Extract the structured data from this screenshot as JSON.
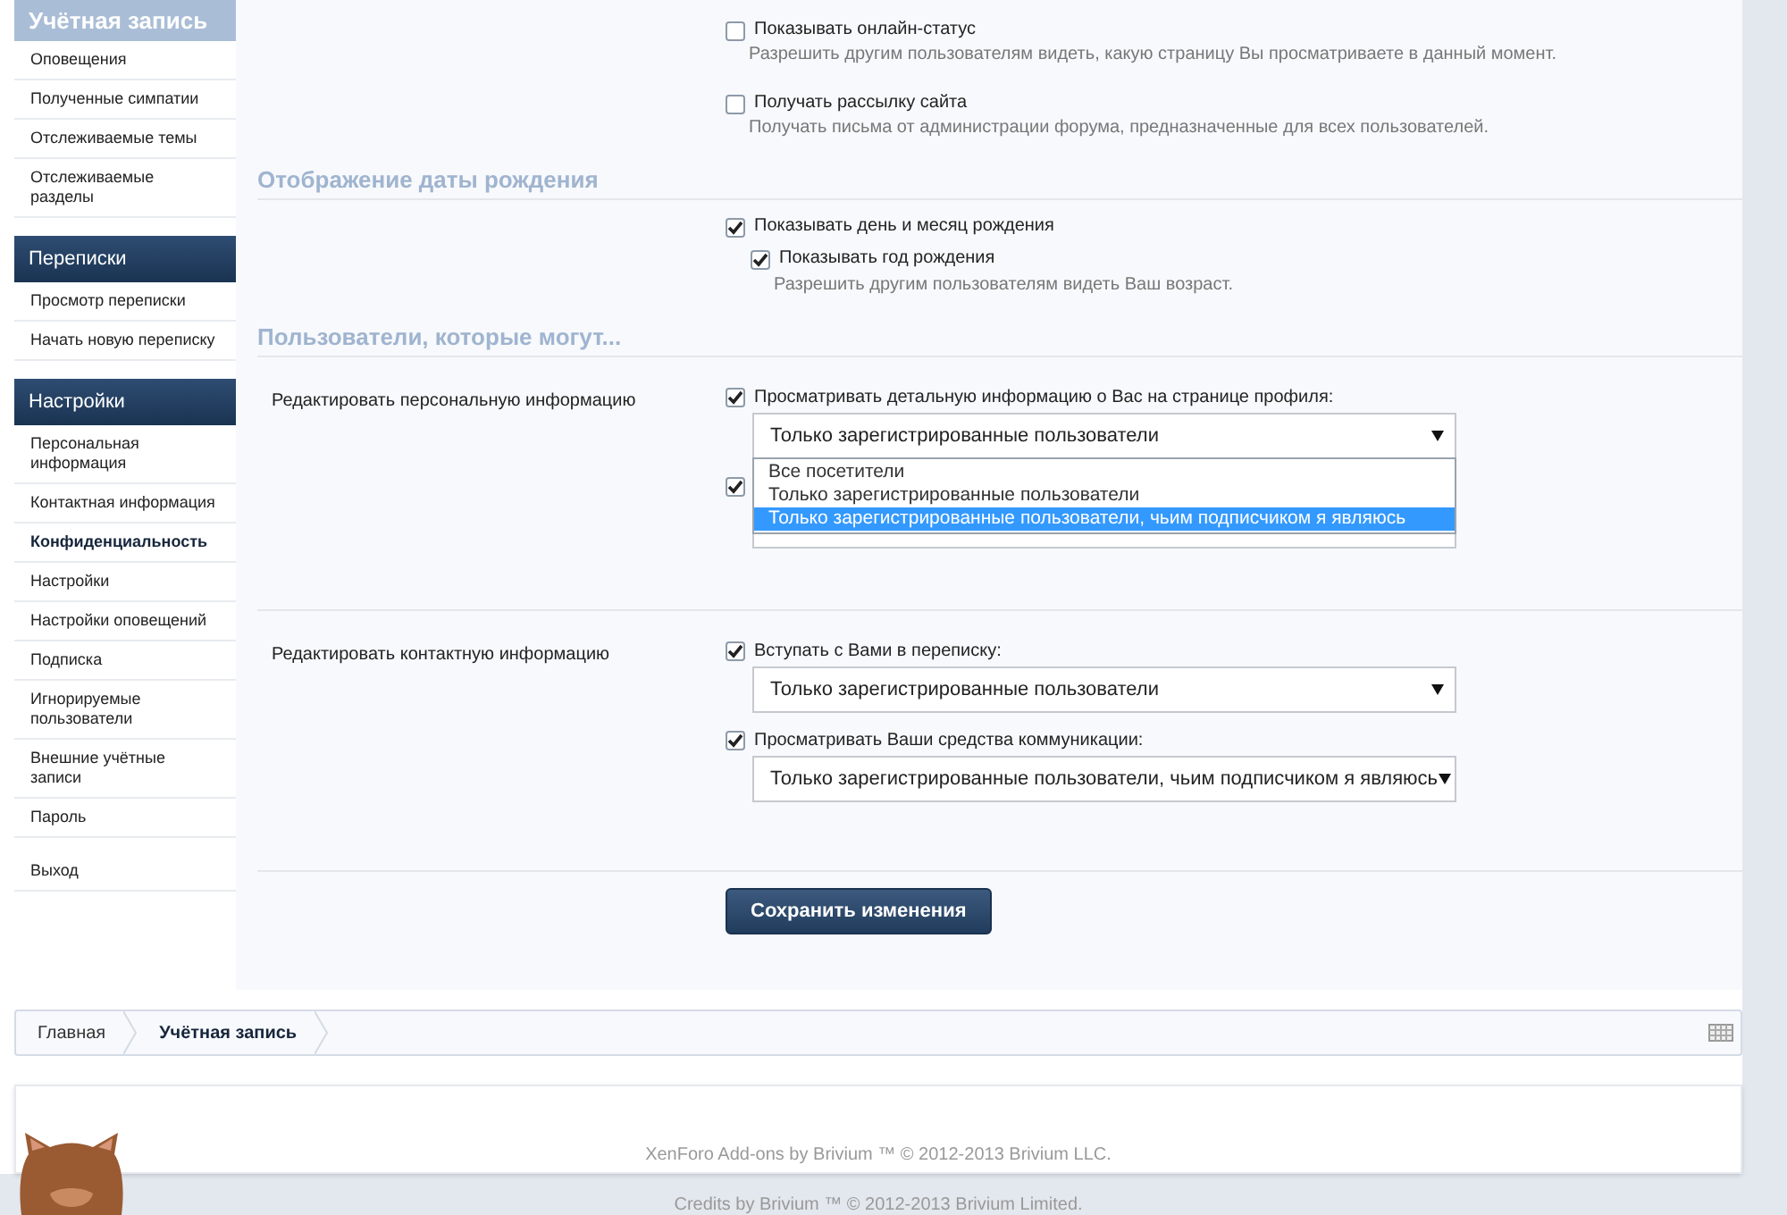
{
  "sidebar": {
    "sections": [
      {
        "title": "Учётная запись",
        "kind": "light",
        "items": [
          {
            "label": "Оповещения",
            "selected": false
          },
          {
            "label": "Полученные симпатии",
            "selected": false
          },
          {
            "label": "Отслеживаемые темы",
            "selected": false
          },
          {
            "label": "Отслеживаемые разделы",
            "selected": false
          }
        ]
      },
      {
        "title": "Переписки",
        "kind": "dark",
        "items": [
          {
            "label": "Просмотр переписки",
            "selected": false
          },
          {
            "label": "Начать новую переписку",
            "selected": false
          }
        ]
      },
      {
        "title": "Настройки",
        "kind": "dark",
        "items": [
          {
            "label": "Персональная информация",
            "selected": false
          },
          {
            "label": "Контактная информация",
            "selected": false
          },
          {
            "label": "Конфиденциальность",
            "selected": true
          },
          {
            "label": "Настройки",
            "selected": false
          },
          {
            "label": "Настройки оповещений",
            "selected": false
          },
          {
            "label": "Подписка",
            "selected": false
          },
          {
            "label": "Игнорируемые пользователи",
            "selected": false
          },
          {
            "label": "Внешние учётные записи",
            "selected": false
          },
          {
            "label": "Пароль",
            "selected": false
          }
        ]
      },
      {
        "kind": "plain",
        "items": [
          {
            "label": "Выход",
            "selected": false
          }
        ]
      }
    ]
  },
  "options": [
    {
      "label": "Показывать онлайн-статус",
      "checked": false,
      "hint": "Разрешить другим пользователям видеть, какую страницу Вы просматриваете в данный момент."
    },
    {
      "label": "Получать рассылку сайта",
      "checked": false,
      "hint": "Получать письма от администрации форума, предназначенные для всех пользователей."
    }
  ],
  "birthday": {
    "heading": "Отображение даты рождения",
    "items": [
      {
        "label": "Показывать день и месяц рождения",
        "checked": true,
        "children": [
          {
            "label": "Показывать год рождения",
            "checked": true,
            "hint": "Разрешить другим пользователям видеть Ваш возраст."
          }
        ]
      }
    ]
  },
  "privacy": {
    "heading": "Пользователи, которые могут...",
    "groups": [
      {
        "label": "Редактировать персональную информацию",
        "items": [
          {
            "label": "Просматривать детальную информацию о Вас на странице профиля:",
            "checked": true,
            "value": "Только зарегистрированные пользователи",
            "open": true
          },
          {
            "checked": true,
            "open": false
          }
        ]
      },
      {
        "label": "Редактировать контактную информацию",
        "items": [
          {
            "label": "Вступать с Вами в переписку:",
            "checked": true,
            "value": "Только зарегистрированные пользователи",
            "open": false
          },
          {
            "label": "Просматривать Ваши средства коммуникации:",
            "checked": true,
            "value": "Только зарегистрированные пользователи, чьим подписчиком я являюсь",
            "open": false
          }
        ]
      }
    ]
  },
  "dropdown": {
    "options": [
      {
        "label": "Все посетители",
        "selected": false
      },
      {
        "label": "Только зарегистрированные пользователи",
        "selected": false
      },
      {
        "label": "Только зарегистрированные пользователи, чьим подписчиком я являюсь",
        "selected": true
      }
    ]
  },
  "save_button": "Сохранить изменения",
  "breadcrumbs": [
    {
      "label": "Главная",
      "selected": false
    },
    {
      "label": "Учётная запись",
      "selected": true
    }
  ],
  "footer": {
    "copyright": "XenForo Add-ons by Brivium ™ © 2012-2013 Brivium LLC.",
    "credits": "Credits by Brivium ™ © 2012-2013 Brivium Limited."
  }
}
